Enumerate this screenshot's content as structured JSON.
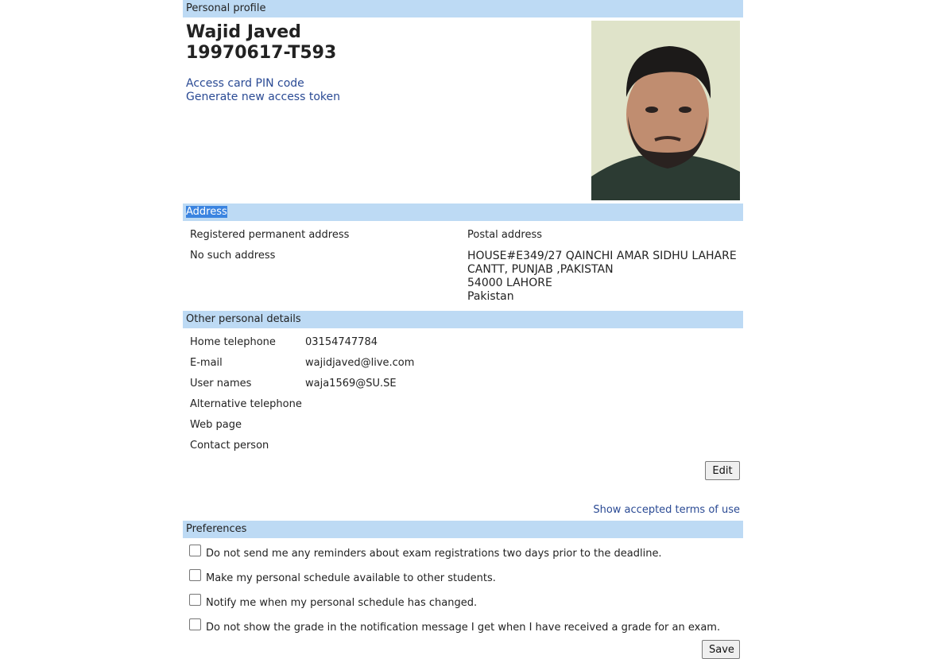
{
  "profile": {
    "header": "Personal profile",
    "name": "Wajid Javed",
    "id_number": "19970617-T593",
    "links": [
      "Access card PIN code",
      "Generate new access token"
    ]
  },
  "address": {
    "header": "Address",
    "permanent_label": "Registered permanent address",
    "permanent_value": "No such address",
    "postal_label": "Postal address",
    "postal_lines": [
      "HOUSE#E349/27 QAINCHI AMAR SIDHU LAHARE",
      "CANTT, PUNJAB ,PAKISTAN",
      "54000 LAHORE",
      "Pakistan"
    ]
  },
  "other": {
    "header": "Other personal details",
    "rows": [
      {
        "label": "Home telephone",
        "value": "03154747784"
      },
      {
        "label": "E-mail",
        "value": "wajidjaved@live.com"
      },
      {
        "label": "User names",
        "value": "waja1569@SU.SE"
      },
      {
        "label": "Alternative telephone",
        "value": ""
      },
      {
        "label": "Web page",
        "value": ""
      },
      {
        "label": "Contact person",
        "value": ""
      }
    ],
    "edit_label": "Edit",
    "terms_link": "Show accepted terms of use"
  },
  "preferences": {
    "header": "Preferences",
    "options": [
      {
        "label": "Do not send me any reminders about exam registrations two days prior to the deadline.",
        "checked": false
      },
      {
        "label": "Make my personal schedule available to other students.",
        "checked": false
      },
      {
        "label": "Notify me when my personal schedule has changed.",
        "checked": false
      },
      {
        "label": "Do not show the grade in the notification message I get when I have received a grade for an exam.",
        "checked": false
      }
    ],
    "save_label": "Save"
  }
}
